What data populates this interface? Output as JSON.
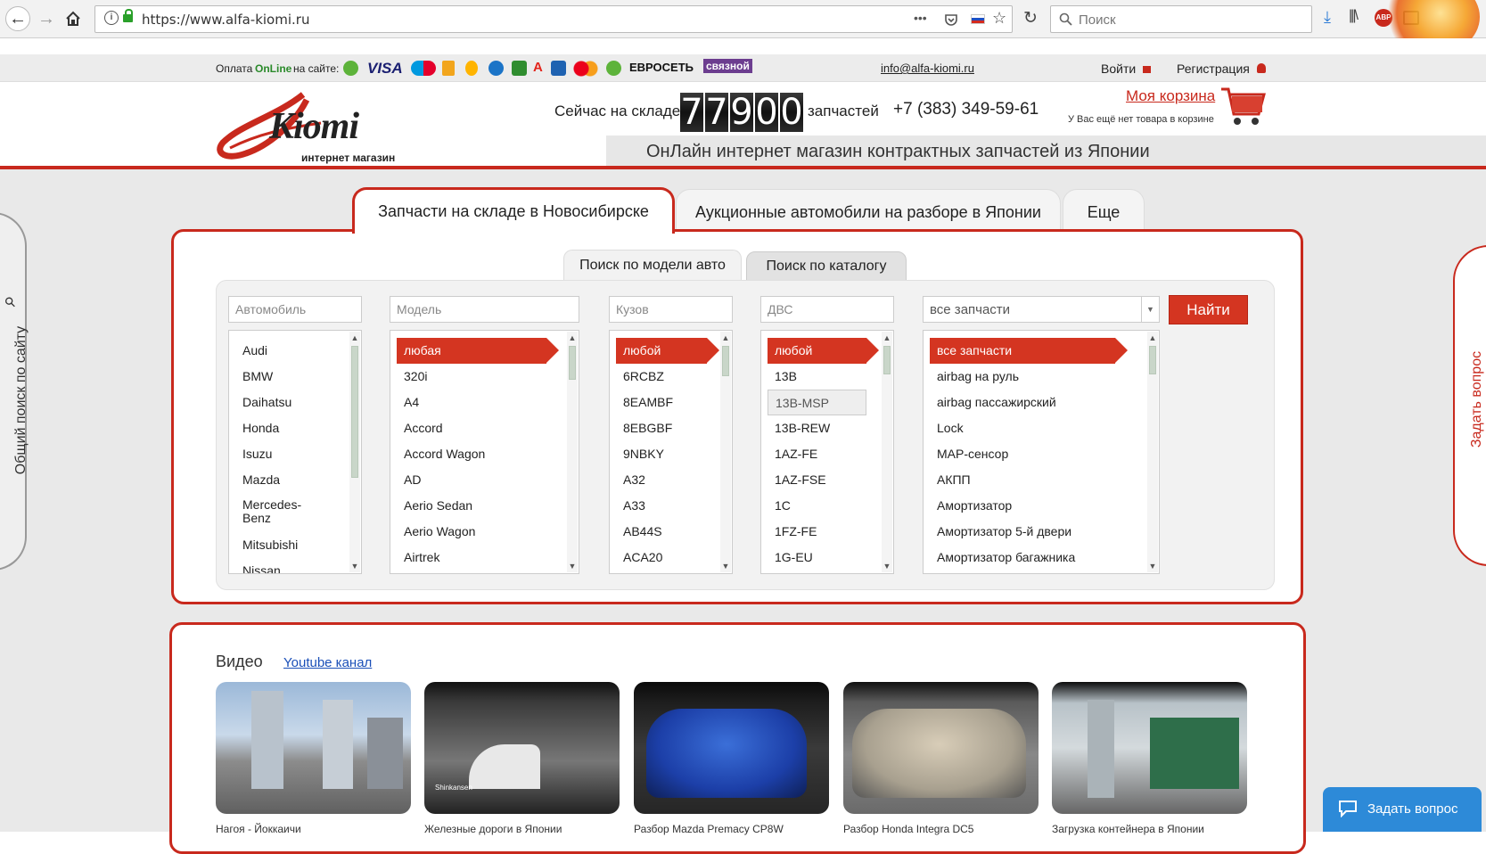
{
  "browser": {
    "url": "https://www.alfa-kiomi.ru",
    "search_placeholder": "Поиск",
    "menu_dots": "•••"
  },
  "paybar": {
    "payment_prefix": "Оплата",
    "payment_online": "OnLine",
    "payment_suffix": "на сайте:",
    "visa": "VISA",
    "euroset": "ЕВРОСЕТЬ",
    "svyaznoy": "связной",
    "email": "info@alfa-kiomi.ru",
    "login": "Войти",
    "register": "Регистрация"
  },
  "header": {
    "logo_text": "Kiomi",
    "logo_sub": "интернет магазин",
    "stock_label": "Сейчас на складе",
    "stock_digits": [
      "7",
      "7",
      "9",
      "0",
      "0"
    ],
    "stock_unit": "запчастей",
    "phone": "+7 (383) 349-59-61",
    "cart_title": "Моя корзина",
    "cart_empty": "У Вас ещё нет товара в корзине",
    "tagline": "ОнЛайн интернет магазин контрактных запчастей из Японии"
  },
  "main_tabs": [
    {
      "label": "Запчасти на складе в Новосибирске"
    },
    {
      "label": "Аукционные автомобили на разборе в Японии"
    },
    {
      "label": "Еще"
    }
  ],
  "sub_tabs": [
    {
      "label": "Поиск по модели авто"
    },
    {
      "label": "Поиск по каталогу"
    }
  ],
  "filters": {
    "car_placeholder": "Автомобиль",
    "model_placeholder": "Модель",
    "body_placeholder": "Кузов",
    "engine_placeholder": "ДВС",
    "parts_select": "все запчасти",
    "find_button": "Найти"
  },
  "lists": {
    "cars": [
      "Audi",
      "BMW",
      "Daihatsu",
      "Honda",
      "Isuzu",
      "Mazda",
      "Mercedes-Benz",
      "Mitsubishi",
      "Nissan"
    ],
    "models": [
      "любая",
      "320i",
      "A4",
      "Accord",
      "Accord Wagon",
      "AD",
      "Aerio Sedan",
      "Aerio Wagon",
      "Airtrek"
    ],
    "bodies": [
      "любой",
      "6RCBZ",
      "8EAMBF",
      "8EBGBF",
      "9NBKY",
      "A32",
      "A33",
      "AB44S",
      "ACA20"
    ],
    "engines": [
      "любой",
      "13B",
      "13B-MSP",
      "13B-REW",
      "1AZ-FE",
      "1AZ-FSE",
      "1C",
      "1FZ-FE",
      "1G-EU"
    ],
    "parts": [
      "все запчасти",
      "airbag на руль",
      "airbag пассажирский",
      "Lock",
      "MAP-сенсор",
      "АКПП",
      "Амортизатор",
      "Амортизатор 5-й двери",
      "Амортизатор багажника"
    ]
  },
  "video": {
    "title": "Видео",
    "youtube_link": "Youtube канал",
    "thumb_caption_2": "Shinkansen",
    "captions": [
      "Нагоя - Йоккаичи",
      "Железные дороги в Японии",
      "Разбор Mazda Premacy CP8W",
      "Разбор Honda Integra DC5",
      "Загрузка контейнера в Японии"
    ]
  },
  "side": {
    "left_tab": "Общий поиск по сайту",
    "right_tab": "Задать вопрос",
    "chat_button": "Задать вопрос"
  },
  "colors": {
    "brand_red": "#c8291d",
    "select_red": "#d43521",
    "chat_blue": "#2d8ad8"
  }
}
